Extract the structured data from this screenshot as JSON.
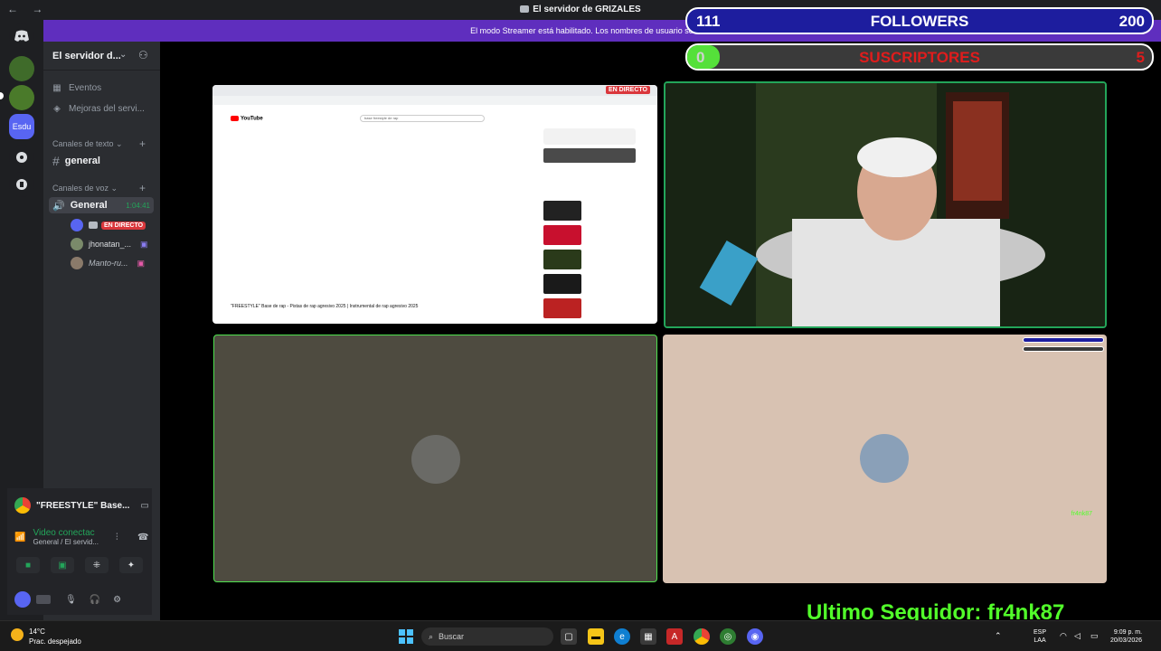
{
  "window": {
    "title": "El servidor de GRIZALES",
    "nav_arrows": "← →"
  },
  "banner": {
    "text": "El modo Streamer está habilitado. Los nombres de usuario se han trunca"
  },
  "server": {
    "name": "El servidor d...",
    "items": [
      {
        "label": "Eventos"
      },
      {
        "label": "Mejoras del servi..."
      }
    ],
    "text_category": "Canales de texto",
    "text_channel": "general",
    "voice_category": "Canales de voz",
    "voice_channel": "General",
    "voice_time": "1:04:41",
    "live_label": "EN DIRECTO",
    "voice_users": [
      {
        "name": "jhonatan_..."
      },
      {
        "name": "Manto-ru..."
      }
    ]
  },
  "activity": {
    "title": "\"FREESTYLE\" Base...",
    "status": "Video conectac",
    "location": "General / El servid..."
  },
  "stage": {
    "live_badge": "EN DIRECTO",
    "yt_logo": "YouTube",
    "yt_search": "base freestyle de rap",
    "yt_video_title": "\"FREESTYLE\" Base de rap - Pistas de rap agresivo 2025 | Instrumental de rap agresivo 2025"
  },
  "overlay": {
    "followers_count": "111",
    "followers_label": "FOLLOWERS",
    "followers_goal": "200",
    "followers_progress": 0.555,
    "subs_count": "0",
    "subs_label": "SUSCRIPTORES",
    "subs_goal": "5",
    "last_follower": "Ultimo Seguidor: fr4nk87",
    "mini_last_follower": "fr4nk87"
  },
  "taskbar": {
    "temp": "14°C",
    "weather": "Prac. despejado",
    "search_placeholder": "Buscar",
    "lang": "ESP",
    "lang2": "LAA",
    "time": "9:09 p. m.",
    "date": "20/03/2026"
  },
  "colors": {
    "discord_blurple": "#5865f2",
    "live_red": "#da373c",
    "green": "#23a55a",
    "overlay_green": "#52ff2a",
    "followers_blue": "#1d1d9e"
  }
}
